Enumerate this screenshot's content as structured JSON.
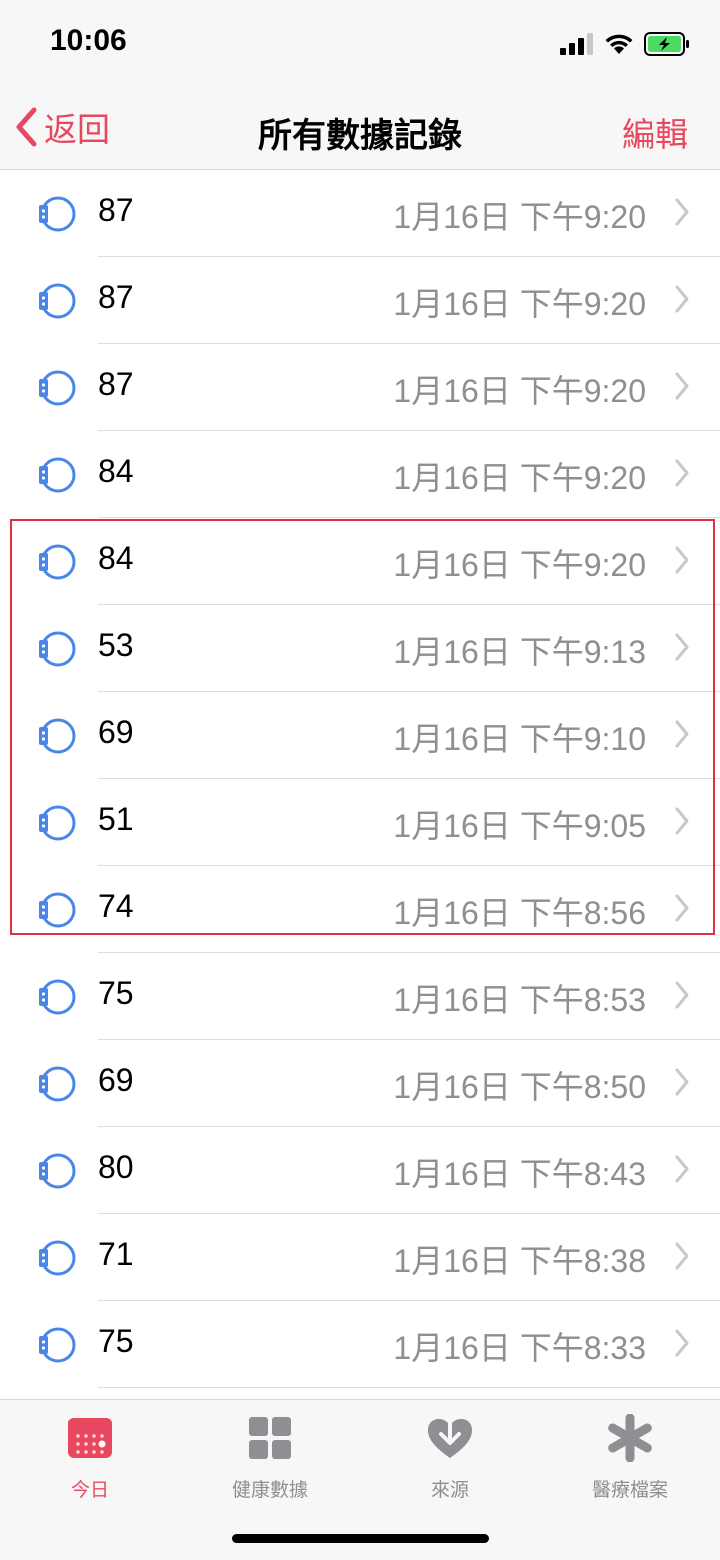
{
  "status": {
    "time": "10:06"
  },
  "nav": {
    "back_label": "返回",
    "title": "所有數據記錄",
    "edit_label": "編輯"
  },
  "records": [
    {
      "value": "87",
      "date": "1月16日 下午9:20"
    },
    {
      "value": "87",
      "date": "1月16日 下午9:20"
    },
    {
      "value": "87",
      "date": "1月16日 下午9:20"
    },
    {
      "value": "84",
      "date": "1月16日 下午9:20"
    },
    {
      "value": "84",
      "date": "1月16日 下午9:20"
    },
    {
      "value": "53",
      "date": "1月16日 下午9:13"
    },
    {
      "value": "69",
      "date": "1月16日 下午9:10"
    },
    {
      "value": "51",
      "date": "1月16日 下午9:05"
    },
    {
      "value": "74",
      "date": "1月16日 下午8:56"
    },
    {
      "value": "75",
      "date": "1月16日 下午8:53"
    },
    {
      "value": "69",
      "date": "1月16日 下午8:50"
    },
    {
      "value": "80",
      "date": "1月16日 下午8:43"
    },
    {
      "value": "71",
      "date": "1月16日 下午8:38"
    },
    {
      "value": "75",
      "date": "1月16日 下午8:33"
    },
    {
      "value": "",
      "date": ""
    }
  ],
  "tabs": [
    {
      "label": "今日",
      "icon": "calendar-icon",
      "active": true
    },
    {
      "label": "健康數據",
      "icon": "grid-icon",
      "active": false
    },
    {
      "label": "來源",
      "icon": "heart-download-icon",
      "active": false
    },
    {
      "label": "醫療檔案",
      "icon": "asterisk-icon",
      "active": false
    }
  ],
  "colors": {
    "accent": "#e8485f",
    "watch_icon": "#4a86e8",
    "highlight": "#e0303e"
  }
}
